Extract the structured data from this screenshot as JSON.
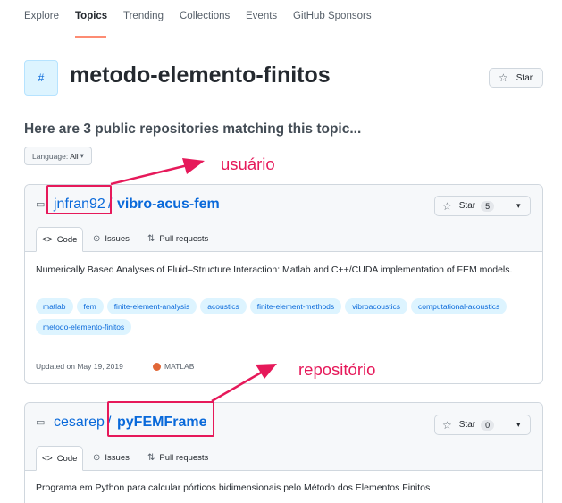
{
  "nav": {
    "items": [
      {
        "label": "Explore",
        "active": false
      },
      {
        "label": "Topics",
        "active": true
      },
      {
        "label": "Trending",
        "active": false
      },
      {
        "label": "Collections",
        "active": false
      },
      {
        "label": "Events",
        "active": false
      },
      {
        "label": "GitHub Sponsors",
        "active": false
      }
    ]
  },
  "topic": {
    "badge": "#",
    "title": "metodo-elemento-finitos",
    "star_label": "Star"
  },
  "subheading": "Here are 3 public repositories matching this topic...",
  "language_filter": {
    "label": "Language:",
    "value": "All"
  },
  "annotations": {
    "user_label": "usuário",
    "repo_label": "repositório",
    "color": "#e6195a"
  },
  "repos": [
    {
      "owner": "jnfran92",
      "slash": "/",
      "name": "vibro-acus-fem",
      "star_label": "Star",
      "star_count": "5",
      "tabs": [
        "Code",
        "Issues",
        "Pull requests"
      ],
      "description": "Numerically Based Analyses of Fluid–Structure Interaction: Matlab and C++/CUDA implementation of FEM models.",
      "tags": [
        "matlab",
        "fem",
        "finite-element-analysis",
        "acoustics",
        "finite-element-methods",
        "vibroacoustics",
        "computational-acoustics",
        "metodo-elemento-finitos"
      ],
      "updated": "Updated on May 19, 2019",
      "language": "MATLAB",
      "language_color": "#e16737"
    },
    {
      "owner": "cesarep",
      "slash": "/",
      "name": "pyFEMFrame",
      "star_label": "Star",
      "star_count": "0",
      "tabs": [
        "Code",
        "Issues",
        "Pull requests"
      ],
      "description": "Programa em Python para calcular pórticos bidimensionais pelo Método dos Elementos Finitos"
    }
  ]
}
